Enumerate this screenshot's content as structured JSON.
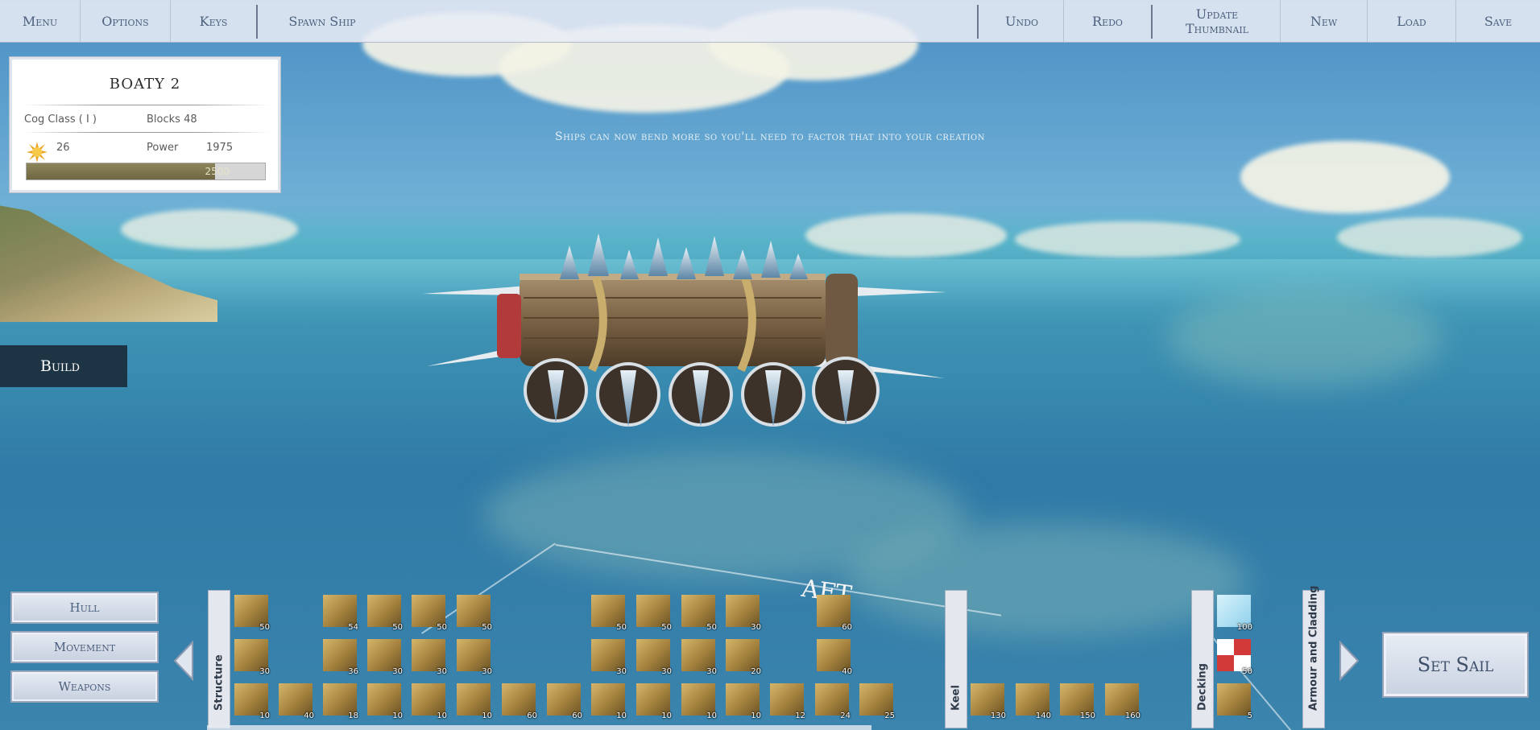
{
  "top_bar": {
    "menu": "Menu",
    "options": "Options",
    "keys": "Keys",
    "spawn_ship": "Spawn Ship",
    "undo": "Undo",
    "redo": "Redo",
    "update_thumbnail": "Update Thumbnail",
    "new": "New",
    "load": "Load",
    "save": "Save"
  },
  "ship_info": {
    "name": "BOATY 2",
    "class": "Cog Class ( I )",
    "blocks": "Blocks 48",
    "crew_count": "26",
    "power_label": "Power",
    "power_value": "1975",
    "power_max": "2500",
    "power_fraction": 0.79
  },
  "hint": "Ships can now bend more so you'll need to factor that into your creation",
  "build_tab": "Build",
  "ground_marker": "AFT",
  "categories": {
    "hull": "Hull",
    "movement": "Movement",
    "weapons": "Weapons"
  },
  "palette_tabs": {
    "structure": "Structure",
    "keel": "Keel",
    "decking": "Decking",
    "armour": "Armour and Cladding"
  },
  "structure_rows": [
    [
      "50",
      "54",
      "50",
      "50",
      "50",
      "50",
      "50",
      "50",
      "30",
      "60"
    ],
    [
      "30",
      "36",
      "30",
      "30",
      "30",
      "30",
      "30",
      "30",
      "20",
      "40"
    ],
    [
      "10",
      "40",
      "18",
      "10",
      "10",
      "10",
      "60",
      "60",
      "10",
      "10",
      "10",
      "10",
      "12",
      "24",
      "25"
    ]
  ],
  "keel_items": [
    "130",
    "140",
    "150",
    "160"
  ],
  "decking_items": [
    "100",
    "50",
    "5"
  ],
  "set_sail": "Set Sail",
  "icons": {
    "crew": "sun-icon",
    "prev": "arrow-left-icon",
    "next": "arrow-right-icon"
  }
}
